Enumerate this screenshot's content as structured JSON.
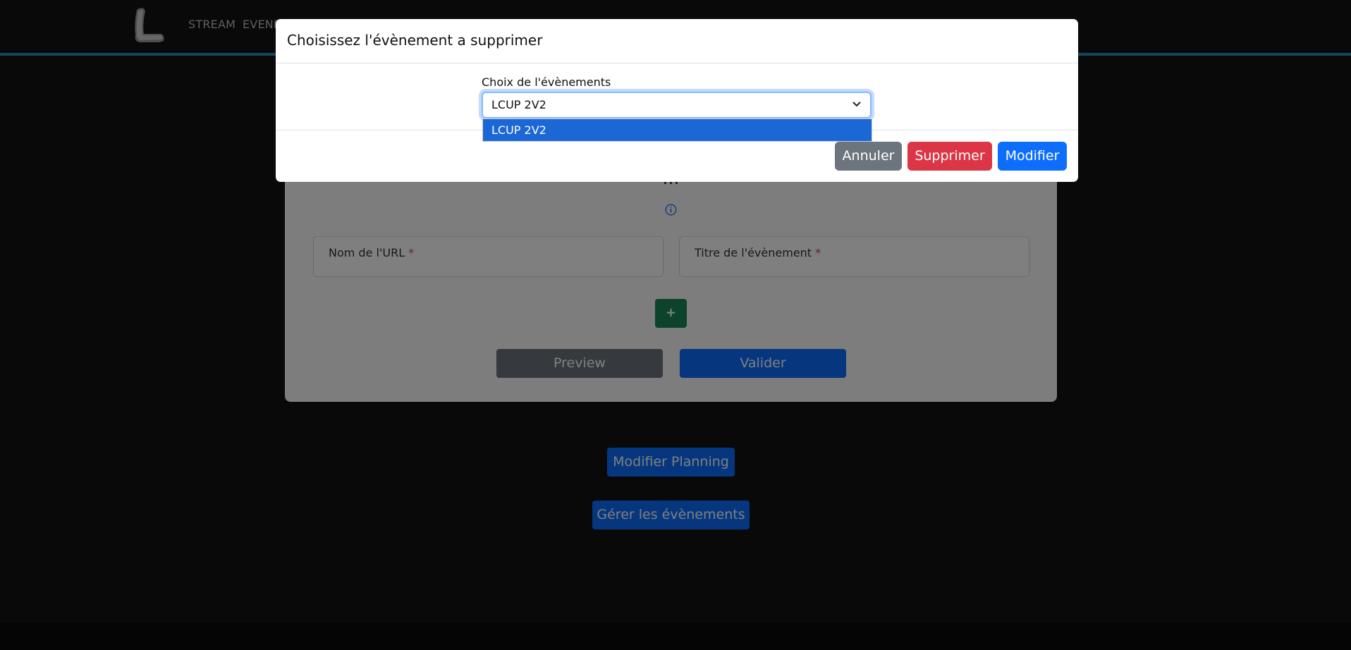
{
  "nav": {
    "items": [
      "STREAM",
      "EVENE"
    ]
  },
  "card": {
    "title": "…",
    "url_field_label": "Nom de l'URL",
    "title_field_label": "Titre de l'évènement",
    "required_mark": "*",
    "plus_label": "+",
    "preview_label": "Preview",
    "valider_label": "Valider"
  },
  "page_buttons": {
    "modifier_planning": "Modifier Planning",
    "gerer_evenements": "Gérer les évènements"
  },
  "modal": {
    "title": "Choisissez l'évènement a supprimer",
    "select_label": "Choix de l'évènements",
    "select_value": "LCUP 2V2",
    "options": [
      "LCUP 2V2"
    ],
    "annuler_label": "Annuler",
    "supprimer_label": "Supprimer",
    "modifier_label": "Modifier"
  },
  "colors": {
    "accent": "#0d6efd",
    "danger": "#dc3545",
    "secondary": "#6c757d",
    "success": "#198754",
    "nav_border": "#2a8dba"
  }
}
